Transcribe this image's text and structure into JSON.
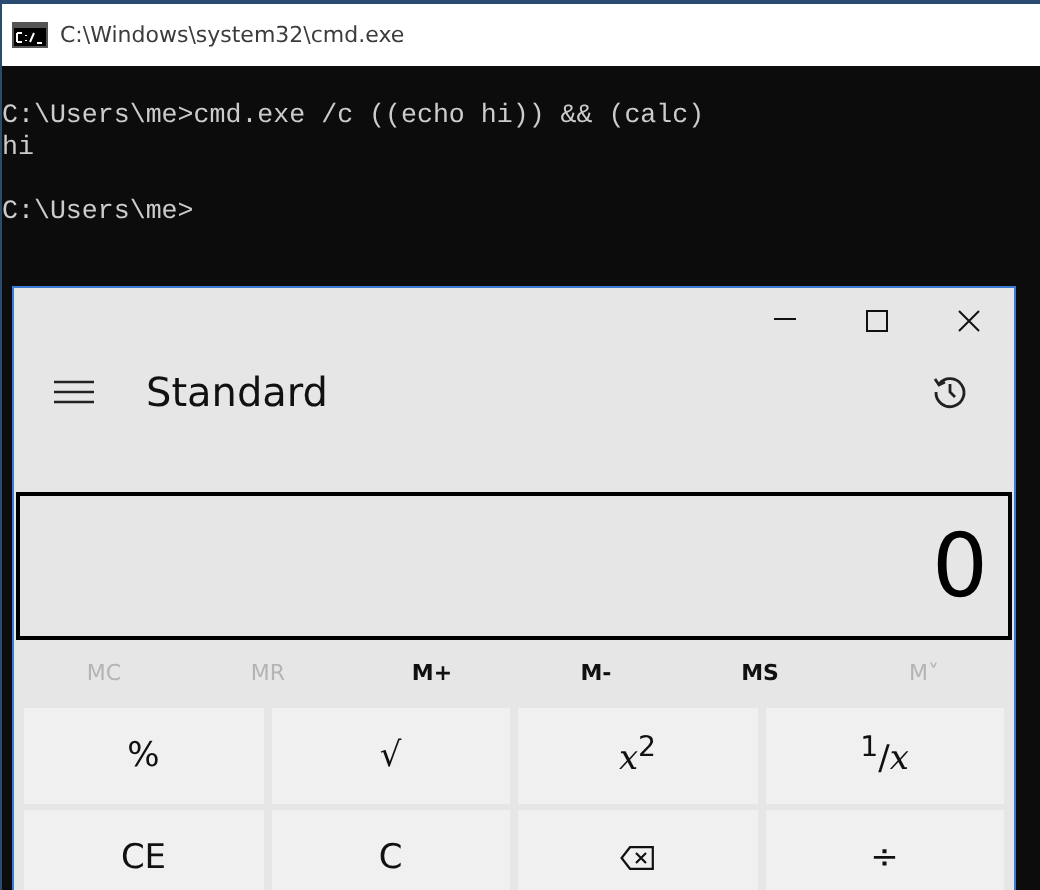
{
  "console_window": {
    "title": "C:\\Windows\\system32\\cmd.exe",
    "command_line": "C:\\Users\\me>cmd.exe /c ((echo hi)) && (calc)",
    "output": "hi",
    "prompt": "C:\\Users\\me>"
  },
  "calculator": {
    "mode": "Standard",
    "display": "0",
    "memory_buttons": [
      {
        "label": "MC",
        "disabled": true
      },
      {
        "label": "MR",
        "disabled": true
      },
      {
        "label": "M+",
        "disabled": false
      },
      {
        "label": "M-",
        "disabled": false
      },
      {
        "label": "MS",
        "disabled": false
      },
      {
        "label": "M˅",
        "disabled": true
      }
    ],
    "keys": [
      {
        "kind": "text",
        "label": "%"
      },
      {
        "kind": "text",
        "label": "√"
      },
      {
        "kind": "text",
        "label": "*x*$^{2}$"
      },
      {
        "kind": "text",
        "label": "$^{1}$/*x*"
      },
      {
        "kind": "text",
        "label": "CE"
      },
      {
        "kind": "text",
        "label": "C"
      },
      {
        "kind": "backspace"
      },
      {
        "kind": "text",
        "label": "÷"
      }
    ]
  }
}
